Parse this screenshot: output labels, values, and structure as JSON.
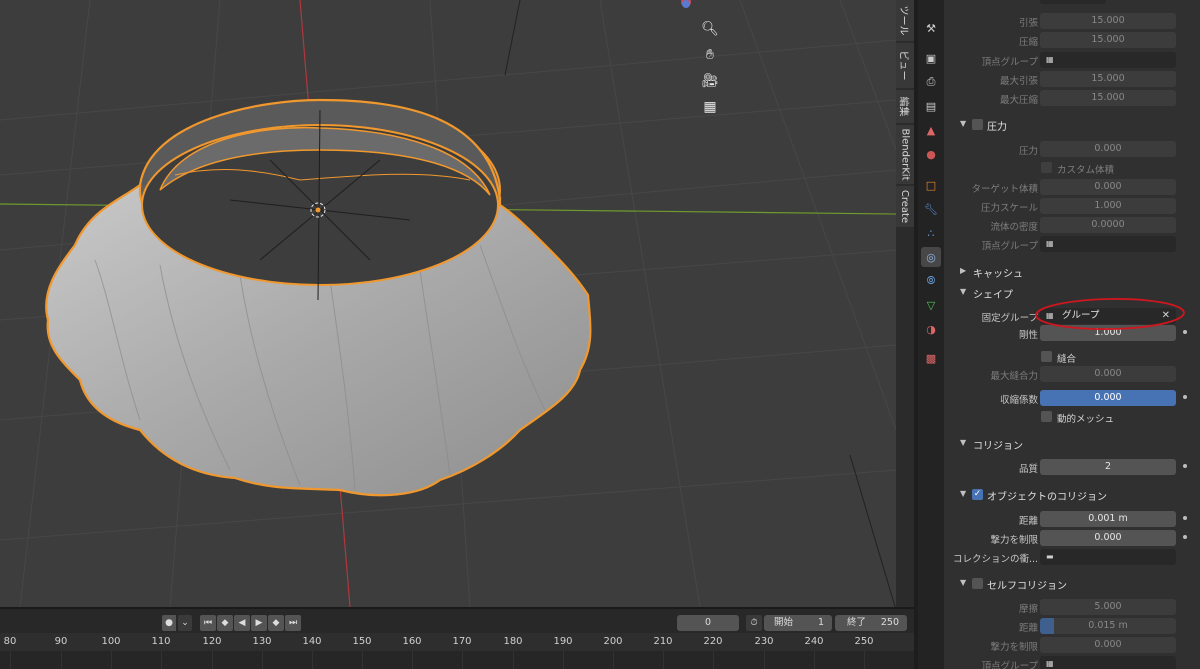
{
  "n_panel_tabs": [
    "ツール",
    "ビュー",
    "編集",
    "BlenderKit",
    "Create"
  ],
  "viewport_nav_icons": [
    "zoom-icon",
    "hand-pan-icon",
    "camera-icon",
    "grid-view-icon"
  ],
  "properties": {
    "top_rows": [
      {
        "label": "引張",
        "value": "15.000"
      },
      {
        "label": "圧縮",
        "value": "15.000"
      },
      {
        "label": "頂点グループ",
        "value": ""
      },
      {
        "label": "最大引張",
        "value": "15.000"
      },
      {
        "label": "最大圧縮",
        "value": "15.000"
      }
    ],
    "pressure": {
      "title": "圧力",
      "pressure_label": "圧力",
      "pressure_value": "0.000",
      "custom_volume": "カスタム体積",
      "target_volume_label": "ターゲット体積",
      "target_volume_value": "0.000",
      "pressure_scale_label": "圧力スケール",
      "pressure_scale_value": "1.000",
      "fluid_density_label": "流体の密度",
      "fluid_density_value": "0.0000",
      "vertex_group_label": "頂点グループ"
    },
    "cache": {
      "title": "キャッシュ"
    },
    "shape": {
      "title": "シェイプ",
      "pin_group_label": "固定グループ",
      "pin_group_value": "グループ",
      "stiffness_label": "剛性",
      "stiffness_value": "1.000",
      "sewing": "縫合",
      "max_sewing_label": "最大縫合力",
      "max_sewing_value": "0.000",
      "shrink_label": "収縮係数",
      "shrink_value": "0.000",
      "dynamic_mesh": "動的メッシュ"
    },
    "collision": {
      "title": "コリジョン",
      "quality_label": "品質",
      "quality_value": "2"
    },
    "object_collision": {
      "title": "オブジェクトのコリジョン",
      "distance_label": "距離",
      "distance_value": "0.001 m",
      "impulse_label": "撃力を制限",
      "impulse_value": "0.000",
      "collection_label": "コレクションの衝..."
    },
    "self_collision": {
      "title": "セルフコリジョン",
      "friction_label": "摩擦",
      "friction_value": "5.000",
      "distance_label": "距離",
      "distance_value": "0.015 m",
      "distance_fraction": 0.1,
      "impulse_label": "撃力を制限",
      "impulse_value": "0.000",
      "vertex_group_label": "頂点グループ"
    }
  },
  "timeline": {
    "current_frame": "0",
    "start_label": "開始",
    "start_value": "1",
    "end_label": "終了",
    "end_value": "250",
    "ruler_ticks": [
      "80",
      "90",
      "100",
      "110",
      "120",
      "130",
      "140",
      "150",
      "160",
      "170",
      "180",
      "190",
      "200",
      "210",
      "220",
      "230",
      "240",
      "250"
    ]
  },
  "colors": {
    "accent_blue": "#4772b3",
    "selection_orange": "#f0982e",
    "annotation_red": "#d0161e",
    "x_axis": "#b0383e",
    "y_axis": "#6f9a2d"
  }
}
